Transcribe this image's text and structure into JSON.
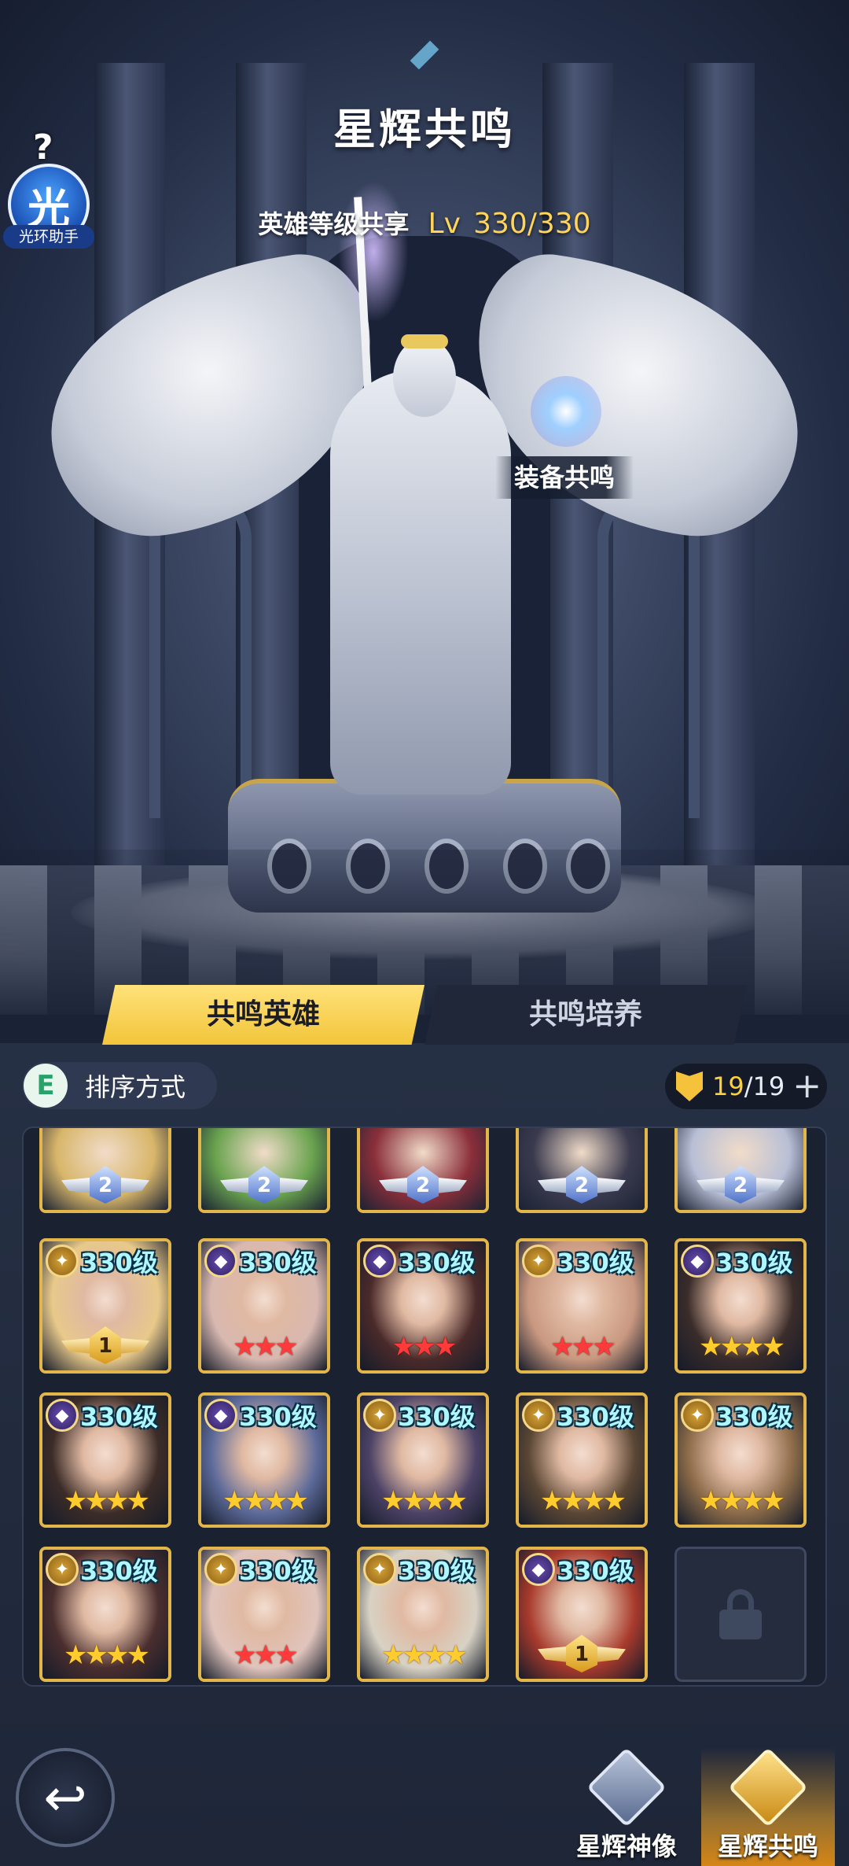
{
  "header": {
    "title": "星辉共鸣",
    "level_label": "英雄等级共享",
    "level_prefix": "Lv",
    "level_value": "330/330"
  },
  "helper": {
    "help_icon": "?",
    "avatar_char": "光",
    "caption": "光环助手"
  },
  "statue": {
    "equip_label": "装备共鸣"
  },
  "tabs": [
    {
      "label": "共鸣英雄",
      "active": true
    },
    {
      "label": "共鸣培养",
      "active": false
    }
  ],
  "toolbar": {
    "sort_icon": "E",
    "sort_label": "排序方式",
    "slot_current": "19",
    "slot_total": "/19",
    "add_icon": "+"
  },
  "heroes": {
    "top_row_partial": [
      {
        "badge": "2",
        "color": "#d8b66a"
      },
      {
        "badge": "2",
        "color": "#6aa34f"
      },
      {
        "badge": "2",
        "color": "#8a2f3a"
      },
      {
        "badge": "2",
        "color": "#3a3a4e"
      },
      {
        "badge": "2",
        "color": "#b8bfd6"
      }
    ],
    "rows": [
      [
        {
          "level": "330级",
          "rank": "gold",
          "badge": "1",
          "stars": "",
          "star_color": "",
          "tone": "#e8c98a"
        },
        {
          "level": "330级",
          "rank": "purple",
          "badge": "",
          "stars": "★★★",
          "star_color": "red",
          "tone": "#d8b8b0"
        },
        {
          "level": "330级",
          "rank": "purple",
          "badge": "",
          "stars": "★★★",
          "star_color": "red",
          "tone": "#4a2a2a"
        },
        {
          "level": "330级",
          "rank": "gold",
          "badge": "",
          "stars": "★★★",
          "star_color": "red",
          "tone": "#c99880"
        },
        {
          "level": "330级",
          "rank": "purple",
          "badge": "",
          "stars": "★★★★",
          "star_color": "gold",
          "tone": "#3a2c2a"
        }
      ],
      [
        {
          "level": "330级",
          "rank": "purple",
          "badge": "",
          "stars": "★★★★",
          "star_color": "gold",
          "tone": "#3c2c28"
        },
        {
          "level": "330级",
          "rank": "purple",
          "badge": "",
          "stars": "★★★★",
          "star_color": "gold",
          "tone": "#5d6a9a"
        },
        {
          "level": "330级",
          "rank": "gold",
          "badge": "",
          "stars": "★★★★",
          "star_color": "gold",
          "tone": "#4c4266"
        },
        {
          "level": "330级",
          "rank": "gold",
          "badge": "",
          "stars": "★★★★",
          "star_color": "gold",
          "tone": "#5a4634"
        },
        {
          "level": "330级",
          "rank": "gold",
          "badge": "",
          "stars": "★★★★",
          "star_color": "gold",
          "tone": "#8a6a48"
        }
      ],
      [
        {
          "level": "330级",
          "rank": "gold",
          "badge": "",
          "stars": "★★★★",
          "star_color": "gold",
          "tone": "#4a2e2e"
        },
        {
          "level": "330级",
          "rank": "gold",
          "badge": "",
          "stars": "★★★",
          "star_color": "red",
          "tone": "#e0c4bc"
        },
        {
          "level": "330级",
          "rank": "gold",
          "badge": "",
          "stars": "★★★★",
          "star_color": "gold",
          "tone": "#d8d2c4"
        },
        {
          "level": "330级",
          "rank": "purple",
          "badge": "1",
          "stars": "",
          "star_color": "",
          "tone": "#a83a2c"
        }
      ]
    ]
  },
  "bottom_nav": {
    "back_icon": "↩",
    "items": [
      {
        "label": "星辉神像",
        "active": false
      },
      {
        "label": "星辉共鸣",
        "active": true
      }
    ]
  },
  "colors": {
    "accent_gold": "#f2c53a",
    "level_teal": "#aef7ff",
    "panel_bg": "#1e2638"
  },
  "icons": [
    "help-icon",
    "sort-icon",
    "shield-icon",
    "plus-icon",
    "lock-icon",
    "back-arrow-icon",
    "statue-emblem-icon",
    "resonance-emblem-icon"
  ]
}
